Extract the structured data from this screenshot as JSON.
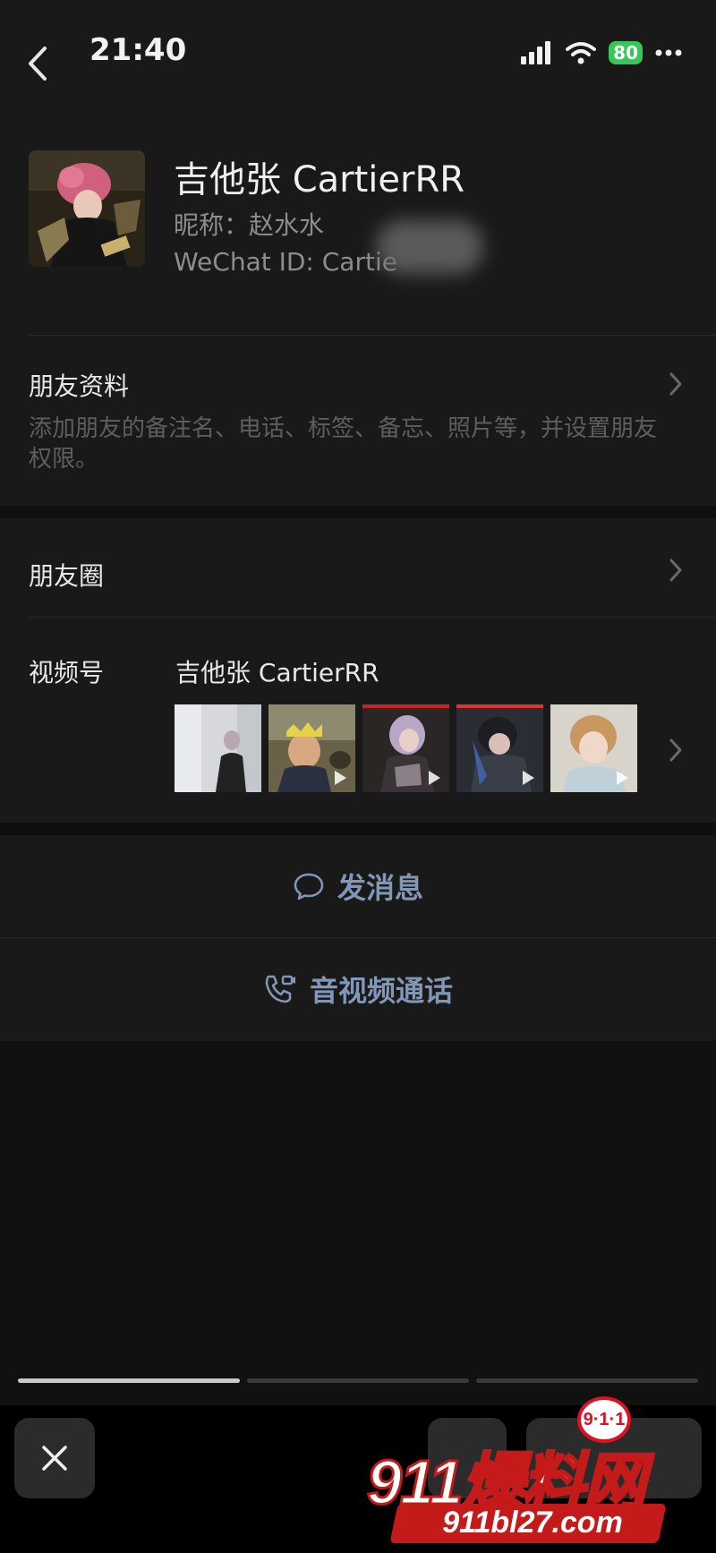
{
  "status_bar": {
    "time": "21:40",
    "battery": "80",
    "icons": [
      "signal-icon",
      "wifi-icon",
      "battery-icon",
      "more-icon"
    ]
  },
  "profile": {
    "remark_name": "吉他张 CartierRR",
    "nickname": "昵称：赵水水",
    "wechat_id": "WeChat ID: Cartie"
  },
  "friend_info": {
    "title": "朋友资料",
    "description": "添加朋友的备注名、电话、标签、备忘、照片等，并设置朋友权限。"
  },
  "moments": {
    "label": "朋友圈"
  },
  "channels": {
    "label": "视频号",
    "name": "吉他张 CartierRR",
    "thumbnail_count_shown": 5
  },
  "actions": {
    "send_message": "发消息",
    "voice_video_call": "音视频通话"
  },
  "watermark": {
    "badge": "9·1·1",
    "brand": "911爆料网",
    "url": "911bl27.com"
  },
  "colors": {
    "background": "#111111",
    "card": "#191919",
    "action_text": "#8097b8",
    "battery": "#35c759"
  }
}
